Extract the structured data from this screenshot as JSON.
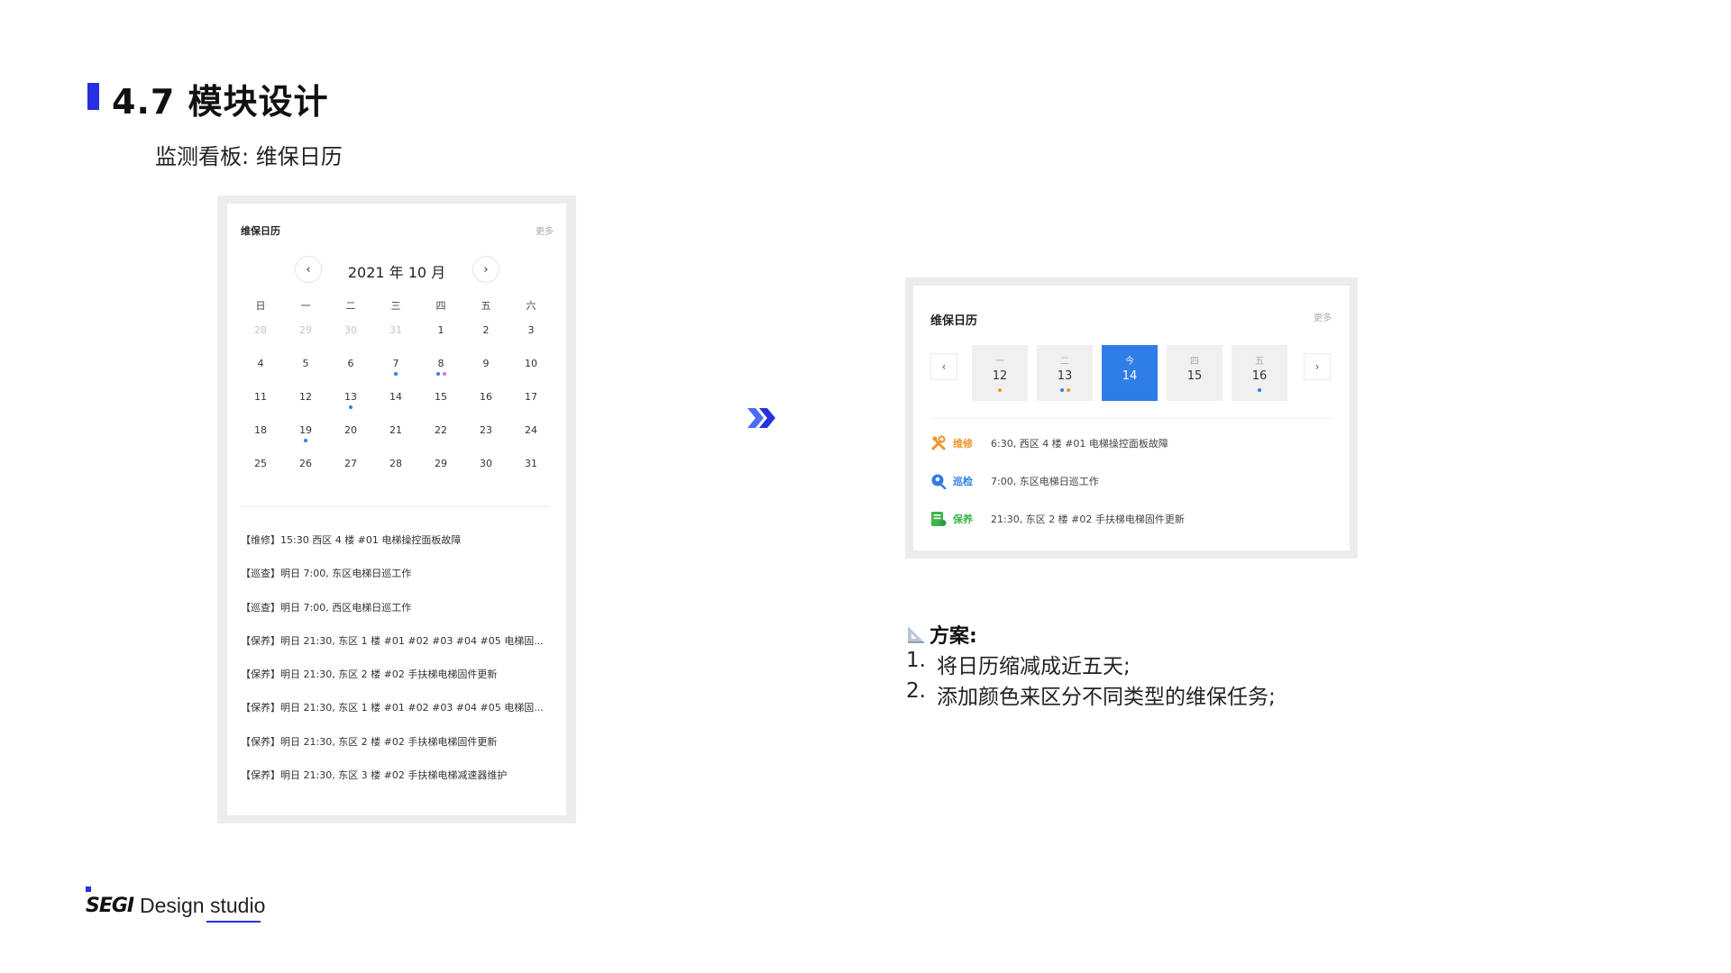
{
  "header": {
    "title": "4.7 模块设计",
    "subtitle": "监测看板: 维保日历"
  },
  "old_calendar": {
    "title": "维保日历",
    "more": "更多",
    "month": "2021 年 10 月",
    "weekdays": [
      "日",
      "一",
      "二",
      "三",
      "四",
      "五",
      "六"
    ],
    "weeks": [
      [
        {
          "d": "28",
          "m": true
        },
        {
          "d": "29",
          "m": true
        },
        {
          "d": "30",
          "m": true
        },
        {
          "d": "31",
          "m": true
        },
        {
          "d": "1"
        },
        {
          "d": "2"
        },
        {
          "d": "3"
        }
      ],
      [
        {
          "d": "4"
        },
        {
          "d": "5"
        },
        {
          "d": "6"
        },
        {
          "d": "7",
          "dots": [
            "#2f7ee8"
          ]
        },
        {
          "d": "8",
          "dots": [
            "#2f7ee8",
            "#c77ddb"
          ]
        },
        {
          "d": "9"
        },
        {
          "d": "10"
        }
      ],
      [
        {
          "d": "11"
        },
        {
          "d": "12"
        },
        {
          "d": "13",
          "dots": [
            "#2f7ee8"
          ]
        },
        {
          "d": "14"
        },
        {
          "d": "15"
        },
        {
          "d": "16"
        },
        {
          "d": "17"
        }
      ],
      [
        {
          "d": "18"
        },
        {
          "d": "19",
          "dots": [
            "#2f7ee8"
          ]
        },
        {
          "d": "20"
        },
        {
          "d": "21"
        },
        {
          "d": "22"
        },
        {
          "d": "23"
        },
        {
          "d": "24"
        }
      ],
      [
        {
          "d": "25"
        },
        {
          "d": "26"
        },
        {
          "d": "27"
        },
        {
          "d": "28"
        },
        {
          "d": "29"
        },
        {
          "d": "30"
        },
        {
          "d": "31"
        }
      ]
    ],
    "tasks": [
      "【维修】15:30 西区 4 楼 #01 电梯操控面板故障",
      "【巡查】明日 7:00, 东区电梯日巡工作",
      "【巡查】明日 7:00, 西区电梯日巡工作",
      "【保养】明日 21:30, 东区 1 楼 #01 #02 #03 #04 #05 电梯固...",
      "【保养】明日 21:30, 东区 2 楼 #02 手扶梯电梯固件更新",
      "【保养】明日 21:30, 东区 1 楼 #01 #02 #03 #04 #05 电梯固...",
      "【保养】明日 21:30, 东区 2 楼 #02 手扶梯电梯固件更新",
      "【保养】明日 21:30, 东区 3 楼 #02 手扶梯电梯减速器维护"
    ]
  },
  "new_calendar": {
    "title": "维保日历",
    "more": "更多",
    "days": [
      {
        "week": "一",
        "num": "12",
        "dots": [
          "#f0932b"
        ],
        "active": false
      },
      {
        "week": "二",
        "num": "13",
        "dots": [
          "#2f7ee8",
          "#f0932b"
        ],
        "active": false
      },
      {
        "week": "今",
        "num": "14",
        "dots": [],
        "active": true
      },
      {
        "week": "四",
        "num": "15",
        "dots": [],
        "active": false
      },
      {
        "week": "五",
        "num": "16",
        "dots": [
          "#2f7ee8"
        ],
        "active": false
      }
    ],
    "tasks": [
      {
        "type": "维修",
        "text": "6:30, 西区 4 楼 #01 电梯操控面板故障",
        "color": "#f0932b",
        "icon": "wrench-icon"
      },
      {
        "type": "巡检",
        "text": "7:00, 东区电梯日巡工作",
        "color": "#2f7ee8",
        "icon": "location-pin-icon"
      },
      {
        "type": "保养",
        "text": "21:30, 东区 2 楼 #02 手扶梯电梯固件更新",
        "color": "#3bb54a",
        "icon": "maintenance-doc-icon"
      }
    ]
  },
  "proposal": {
    "title": "方案:",
    "items": [
      {
        "num": "1.",
        "text": "将日历缩减成近五天;"
      },
      {
        "num": "2.",
        "text": "添加颜色来区分不同类型的维保任务;"
      }
    ]
  },
  "footer": {
    "logo_mark": "SEGI",
    "logo_text": "Design studio"
  },
  "colors": {
    "accent": "#2530e0",
    "today": "#2f7ee8",
    "repair": "#f0932b",
    "inspect": "#2f7ee8",
    "maintain": "#3bb54a"
  }
}
